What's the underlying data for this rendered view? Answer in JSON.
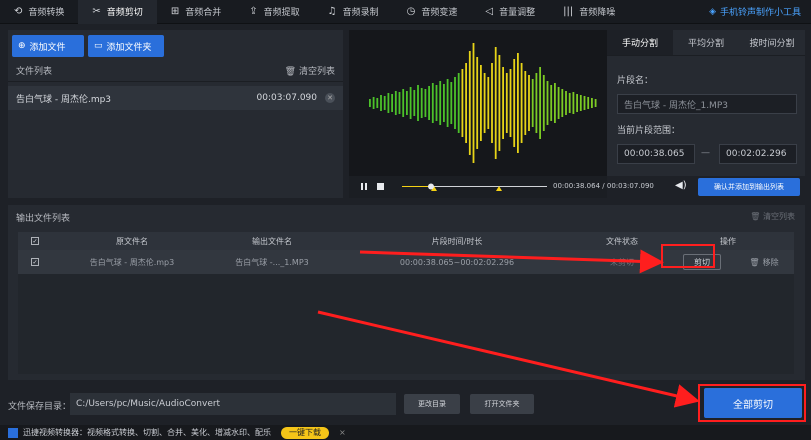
{
  "tabs": [
    {
      "icon": "convert-icon",
      "glyph": "⟲",
      "label": "音频转换"
    },
    {
      "icon": "scissors-icon",
      "glyph": "✂",
      "label": "音频剪切"
    },
    {
      "icon": "merge-icon",
      "glyph": "⊞",
      "label": "音频合并"
    },
    {
      "icon": "extract-icon",
      "glyph": "⇪",
      "label": "音频提取"
    },
    {
      "icon": "mic-icon",
      "glyph": "♫",
      "label": "音频录制"
    },
    {
      "icon": "speed-icon",
      "glyph": "◷",
      "label": "音频变速"
    },
    {
      "icon": "volume-icon",
      "glyph": "◁",
      "label": "音量调整"
    },
    {
      "icon": "noise-icon",
      "glyph": "|||",
      "label": "音频降噪"
    }
  ],
  "top_right": {
    "icon": "ringtone-icon",
    "label": "手机铃声制作小工具"
  },
  "left_panel": {
    "add_file": "添加文件",
    "add_folder": "添加文件夹",
    "file_list_label": "文件列表",
    "clear_list": "清空列表",
    "file": {
      "name": "告白气球 - 周杰伦.mp3",
      "duration": "00:03:07.090"
    }
  },
  "right_panel": {
    "tabs": [
      "手动分割",
      "平均分割",
      "按时间分割"
    ],
    "segment_name_label": "片段名：",
    "segment_name": "告白气球 - 周杰伦_1.MP3",
    "range_label": "当前片段范围：",
    "start": "00:00:38.065",
    "dash": "—",
    "end": "00:02:02.296"
  },
  "transport": {
    "current": "00:00:38.064",
    "sep": "/",
    "total": "00:03:07.090",
    "confirm_button": "确认并添加到输出列表",
    "progress": 0.2
  },
  "output": {
    "title": "输出文件列表",
    "clear": "清空列表",
    "headers": {
      "source": "原文件名",
      "output": "输出文件名",
      "time": "片段时间/时长",
      "status": "文件状态",
      "action": "操作"
    },
    "row": {
      "source": "告白气球 - 周杰伦.mp3",
      "output": "告白气球 -..._1.MP3",
      "time": "00:00:38.065~00:02:02.296",
      "status": "未剪切",
      "cut": "剪切",
      "remove": "移除"
    }
  },
  "bottom": {
    "dir_label": "文件保存目录：",
    "dir_value": "C:/Users/pc/Music/AudioConvert",
    "change_dir": "更改目录",
    "open_folder": "打开文件夹",
    "cut_all": "全部剪切"
  },
  "footer": {
    "text": "迅捷视频转换器：视频格式转换、切割、合并、美化、增减水印、配乐",
    "download": "一键下载",
    "close": "×"
  },
  "colors": {
    "accent": "#2a6fdb",
    "wave_green": "#5bd12a",
    "wave_yellow": "#f5d214",
    "highlight": "#ff1e1e"
  }
}
